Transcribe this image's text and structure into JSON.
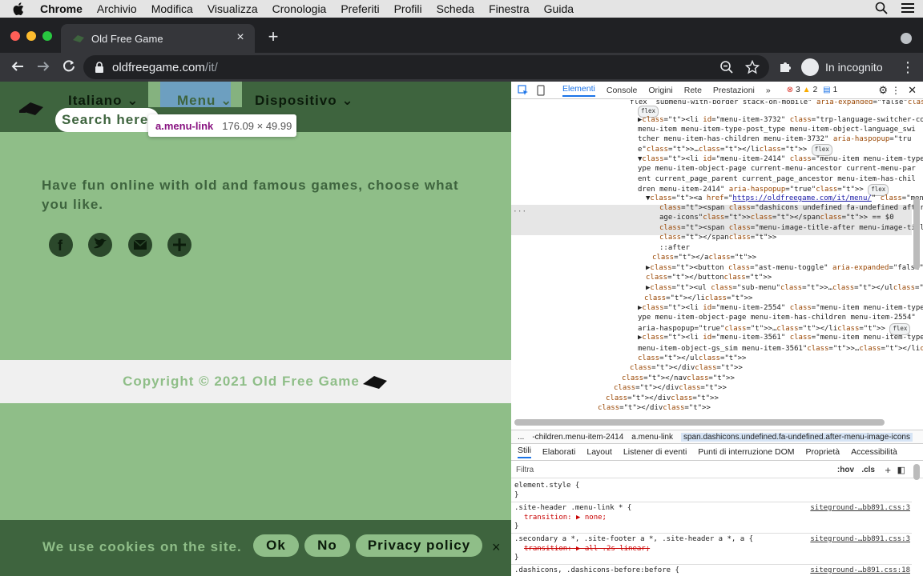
{
  "mac_menu": {
    "app": "Chrome",
    "items": [
      "Archivio",
      "Modifica",
      "Visualizza",
      "Cronologia",
      "Preferiti",
      "Profili",
      "Scheda",
      "Finestra",
      "Guida"
    ]
  },
  "tab": {
    "title": "Old Free Game",
    "close": "×",
    "new": "+"
  },
  "omnibox": {
    "host": "oldfreegame.com",
    "path": "/it/"
  },
  "incognito": {
    "label": "In incognito"
  },
  "site": {
    "nav": {
      "lang": "Italiano ⌄",
      "menu": "Menu ⌄",
      "device": "Dispositivo ⌄"
    },
    "search": "Search here",
    "tooltip": {
      "selector": "a.menu-link",
      "dims": "176.09 × 49.99"
    },
    "tagline": "Have fun online with old and famous games, choose what you like.",
    "footer": "Copyright © 2021 Old Free Game",
    "cookie": {
      "msg": "We use cookies on the site.",
      "ok": "Ok",
      "no": "No",
      "policy": "Privacy policy",
      "close": "×"
    },
    "colors": {
      "header": "#3e643e",
      "body": "#8fbe88"
    }
  },
  "devtools": {
    "tabs": [
      "Elementi",
      "Console",
      "Origini",
      "Rete",
      "Prestazioni",
      "»"
    ],
    "errors": "3",
    "warnings": "2",
    "messages": "1",
    "dom": [
      {
        "t": "flex  submenu-with-border stack-on-mobile\" aria-expanded=\"false\">"
      },
      {
        "t": "flex"
      },
      {
        "t": "▶<li id=\"menu-item-3732\" class=\"trp-language-switcher-container"
      },
      {
        "t": "menu-item menu-item-type-post_type menu-item-object-language_swi"
      },
      {
        "t": "tcher menu-item-has-children menu-item-3732\" aria-haspopup=\"tru"
      },
      {
        "t": "e\">…</li> flex"
      },
      {
        "t": "▼<li id=\"menu-item-2414\" class=\"menu-item menu-item-type-post_t"
      },
      {
        "t": "ype menu-item-object-page current-menu-ancestor current-menu-par"
      },
      {
        "t": "ent current_page_parent current_page_ancestor menu-item-has-chil"
      },
      {
        "t": "dren menu-item-2414\" aria-haspopup=\"true\"> flex"
      },
      {
        "t": "▼<a href=\"https://oldfreegame.com/it/menu/\" class=\"menu-link\">"
      },
      {
        "t": "<span class=\"dashicons undefined fa-undefined after-menu-im"
      },
      {
        "t": "age-icons\"></span> == $0"
      },
      {
        "t": "<span class=\"menu-image-title-after menu-image-title\">Menu"
      },
      {
        "t": "</span>"
      },
      {
        "t": "::after"
      },
      {
        "t": "</a>"
      },
      {
        "t": "▶<button class=\"ast-menu-toggle\" aria-expanded=\"false\">…"
      },
      {
        "t": "</button>"
      },
      {
        "t": "▶<ul class=\"sub-menu\">…</ul>"
      },
      {
        "t": "</li>"
      },
      {
        "t": "▶<li id=\"menu-item-2554\" class=\"menu-item menu-item-type-post_t"
      },
      {
        "t": "ype menu-item-object-page menu-item-has-children menu-item-2554\""
      },
      {
        "t": "aria-haspopup=\"true\">…</li> flex"
      },
      {
        "t": "▶<li id=\"menu-item-3561\" class=\"menu-item menu-item-type-gs_sim"
      },
      {
        "t": "menu-item-object-gs_sim menu-item-3561\">…</li> flex"
      },
      {
        "t": "</ul>"
      },
      {
        "t": "</div>"
      },
      {
        "t": "</nav>"
      },
      {
        "t": "</div>"
      },
      {
        "t": "</div>"
      },
      {
        "t": "</div>"
      }
    ],
    "crumbs": [
      "...",
      "-children.menu-item-2414",
      "a.menu-link",
      "span.dashicons.undefined.fa-undefined.after-menu-image-icons"
    ],
    "style_tabs": [
      "Stili",
      "Elaborati",
      "Layout",
      "Listener di eventi",
      "Punti di interruzione DOM",
      "Proprietà",
      "Accessibilità"
    ],
    "filter": "Filtra",
    "hov": ":hov",
    "cls": ".cls",
    "rules": [
      {
        "sel": "element.style {",
        "body": "}",
        "src": ""
      },
      {
        "sel": ".site-header .menu-link * {",
        "body": "transition: ▶ none;",
        "src": "siteground-…bb891.css:3"
      },
      {
        "sel": ".secondary a *, .site-footer a *, .site-header a *, a {",
        "body": "transition: ▶ all .2s linear;",
        "src": "siteground-…bb891.css:3"
      },
      {
        "sel": ".dashicons, .dashicons-before:before {",
        "body": "",
        "src": "siteground-…b891.css:18"
      }
    ]
  }
}
